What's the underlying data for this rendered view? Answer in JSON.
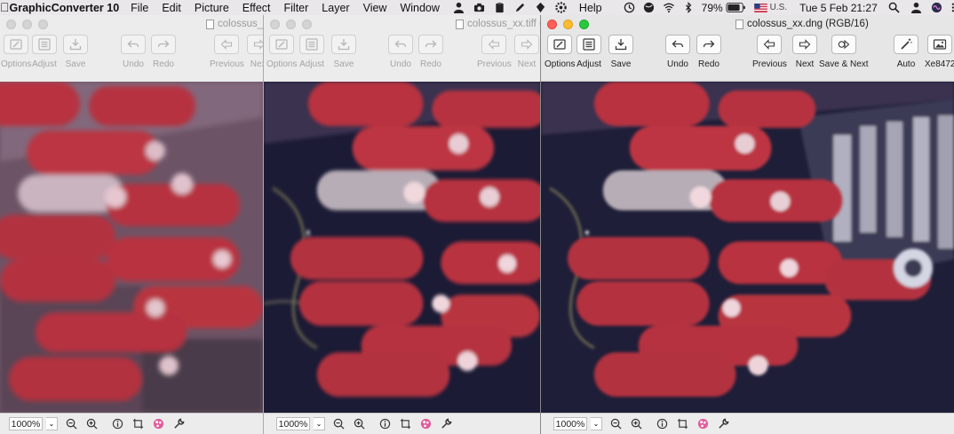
{
  "menubar": {
    "app_name": "GraphicConverter 10",
    "menus": [
      "File",
      "Edit",
      "Picture",
      "Effect",
      "Filter",
      "Layer",
      "View",
      "Window",
      "Help"
    ],
    "battery": "79%",
    "input_source": "U.S.",
    "clock": "Tue 5 Feb  21:27"
  },
  "windows": [
    {
      "title": "colossus_xx.jpg",
      "toolbar": [
        {
          "label": "Options"
        },
        {
          "label": "Adjust"
        },
        {
          "label": "Save"
        },
        {
          "label": "Undo"
        },
        {
          "label": "Redo"
        },
        {
          "label": "Previous"
        },
        {
          "label": "Next"
        }
      ],
      "zoom": "1000%"
    },
    {
      "title": "colossus_xx.tiff (R",
      "toolbar": [
        {
          "label": "Options"
        },
        {
          "label": "Adjust"
        },
        {
          "label": "Save"
        },
        {
          "label": "Undo"
        },
        {
          "label": "Redo"
        },
        {
          "label": "Previous"
        },
        {
          "label": "Next"
        }
      ],
      "zoom": "1000%"
    },
    {
      "title": "colossus_xx.dng (RGB/16)",
      "toolbar": [
        {
          "label": "Options"
        },
        {
          "label": "Adjust"
        },
        {
          "label": "Save"
        },
        {
          "label": "Undo"
        },
        {
          "label": "Redo"
        },
        {
          "label": "Previous"
        },
        {
          "label": "Next"
        },
        {
          "label": "Save & Next"
        },
        {
          "label": "Auto"
        },
        {
          "label": "Xe8472"
        }
      ],
      "zoom": "1000%"
    }
  ],
  "colors": {
    "background_dark": "#1b1b2b",
    "valve_red": "#b8333f",
    "valve_highlight": "#e6c6cf",
    "active_close": "#fe5f57",
    "active_minimize": "#febc2e",
    "active_zoom": "#28c840"
  }
}
